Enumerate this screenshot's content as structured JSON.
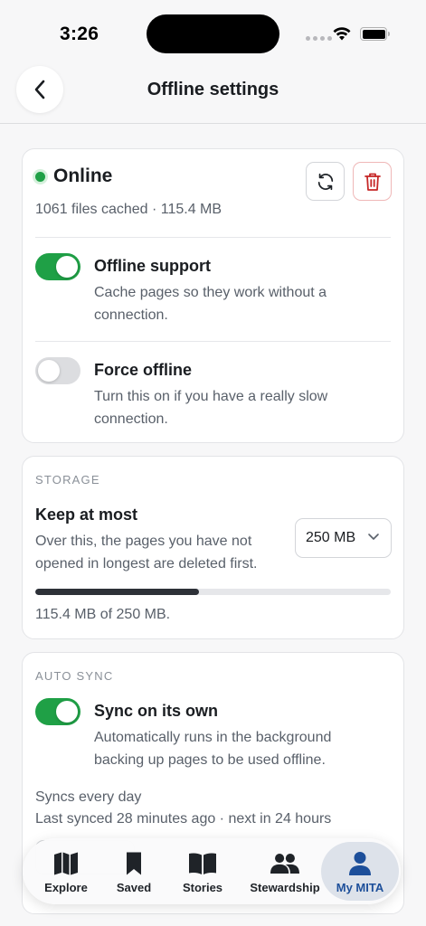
{
  "status_bar": {
    "time": "3:26"
  },
  "header": {
    "title": "Offline settings"
  },
  "connection": {
    "status": "Online",
    "status_color": "#1fa046",
    "cache_info": "1061 files cached · 115.4 MB"
  },
  "settings": [
    {
      "title": "Offline support",
      "description": "Cache pages so they work without a connection.",
      "enabled": true
    },
    {
      "title": "Force offline",
      "description": "Turn this on if you have a really slow connection.",
      "enabled": false
    }
  ],
  "storage": {
    "section_label": "STORAGE",
    "keep_title": "Keep at most",
    "keep_description": "Over this, the pages you have not opened in longest are deleted first.",
    "selected_limit": "250 MB",
    "usage_fraction": 0.46,
    "usage_text": "115.4 MB of 250 MB."
  },
  "auto_sync": {
    "section_label": "AUTO SYNC",
    "title": "Sync on its own",
    "description": "Automatically runs in the background backing up pages to be used offline.",
    "enabled": true,
    "frequency": "Syncs every day",
    "last_synced": "Last synced 28 minutes ago · next in 24 hours"
  },
  "tab_bar": {
    "tabs": [
      {
        "label": "Explore",
        "icon": "map-icon"
      },
      {
        "label": "Saved",
        "icon": "bookmark-icon"
      },
      {
        "label": "Stories",
        "icon": "book-icon"
      },
      {
        "label": "Stewardship",
        "icon": "people-icon"
      },
      {
        "label": "My MITA",
        "icon": "person-icon",
        "active": true
      }
    ],
    "active_color": "#1d4f9a"
  }
}
